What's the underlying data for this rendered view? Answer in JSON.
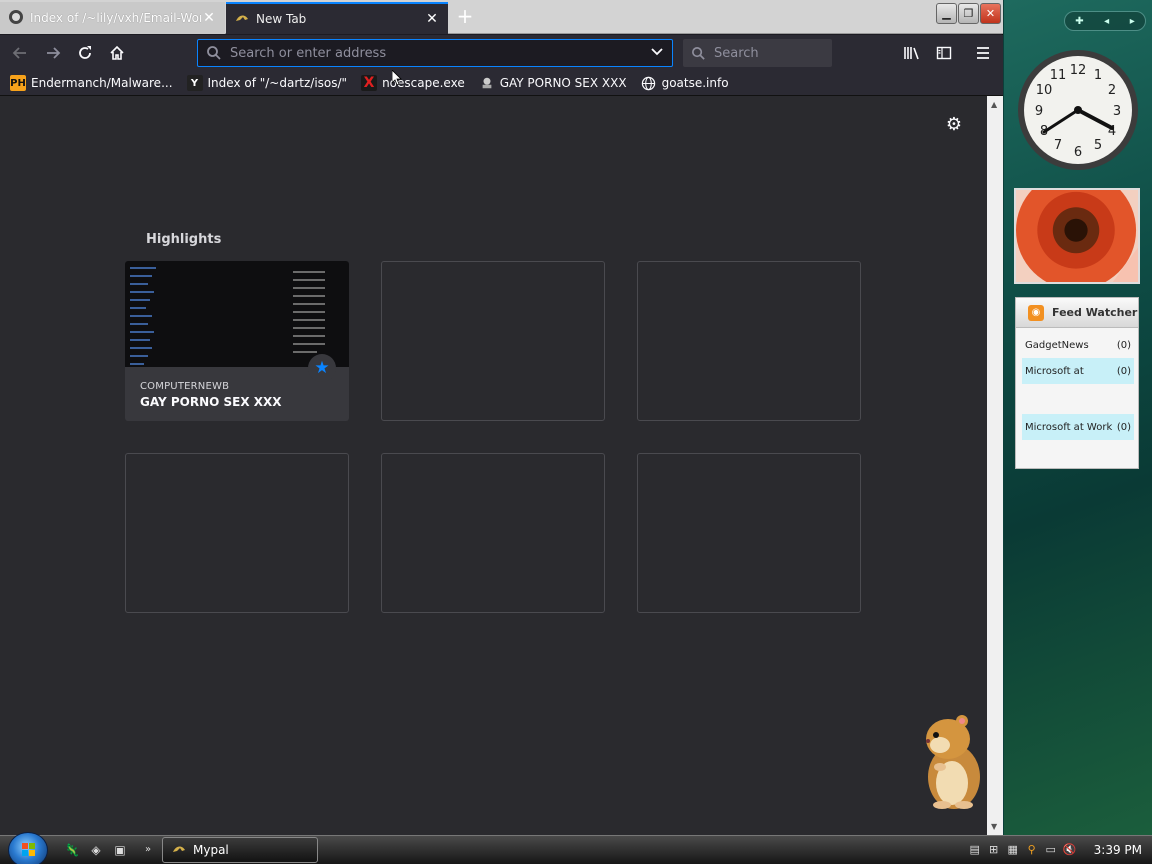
{
  "tabs": [
    {
      "title": "Index of /~lily/vxh/Email-Worm/",
      "active": false
    },
    {
      "title": "New Tab",
      "active": true
    }
  ],
  "urlbar": {
    "placeholder": "Search or enter address"
  },
  "searchbar": {
    "placeholder": "Search"
  },
  "bookmarks": [
    {
      "label": "Endermanch/Malware...",
      "icon": "PH"
    },
    {
      "label": "Index of \"/~dartz/isos/\"",
      "icon": "Y"
    },
    {
      "label": "noescape.exe",
      "icon": "X"
    },
    {
      "label": "GAY PORNO SEX XXX",
      "icon": "gecko-icon"
    },
    {
      "label": "goatse.info",
      "icon": "globe-icon"
    }
  ],
  "newtab": {
    "highlights_title": "Highlights",
    "cards": [
      {
        "source": "COMPUTERNEWB",
        "title": "GAY PORNO SEX XXX",
        "bookmarked": true
      }
    ]
  },
  "sidebar": {
    "feed": {
      "title": "Feed Watcher",
      "items": [
        {
          "name": "GadgetNews",
          "count": "(0)"
        },
        {
          "name": "Microsoft at",
          "count": "(0)"
        },
        {
          "name": "Microsoft at Work",
          "count": "(0)"
        }
      ]
    }
  },
  "taskbar": {
    "window_label": "Mypal",
    "time": "3:39 PM"
  },
  "colors": {
    "accent": "#0a84ff",
    "content_bg": "#2a2a2e",
    "toolbar_bg": "#2b2a33"
  }
}
